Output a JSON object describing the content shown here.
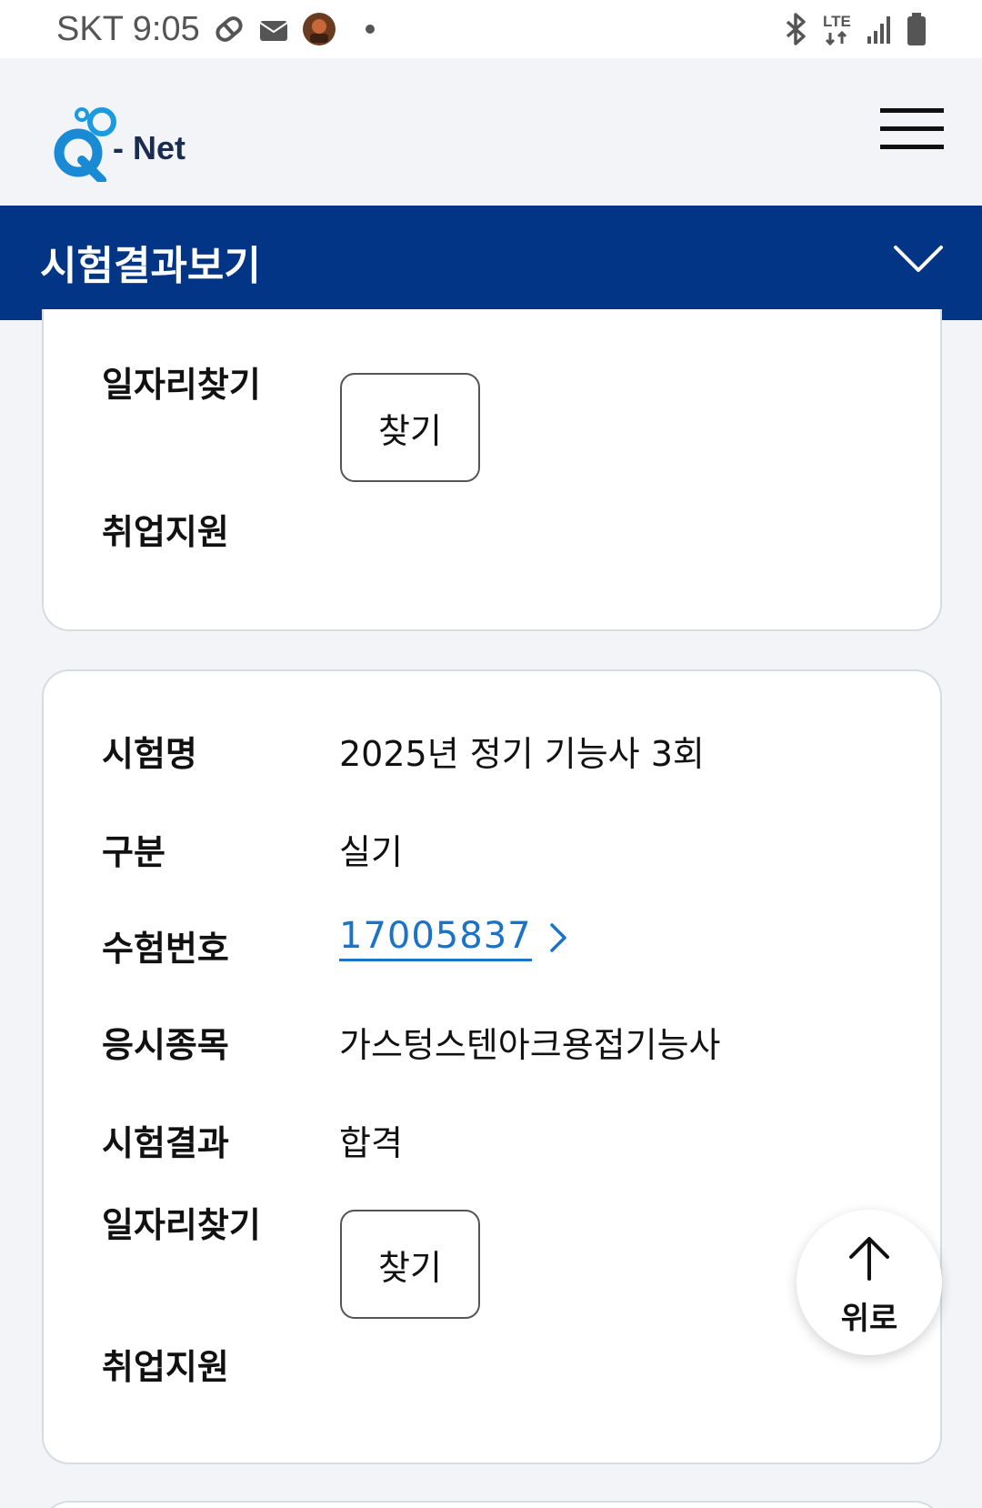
{
  "status_bar": {
    "carrier_time": "SKT 9:05",
    "network": "LTE",
    "icons": [
      "pill-icon",
      "mail-icon",
      "avatar",
      "bluetooth-icon",
      "lte-icon",
      "signal-icon",
      "battery-icon"
    ]
  },
  "header": {
    "logo_text": "- Net",
    "menu_icon": "hamburger-icon"
  },
  "title_bar": {
    "title": "시험결과보기",
    "chevron_icon": "chevron-down-icon",
    "background": "#023586"
  },
  "card1": {
    "job_label": "일자리찾기",
    "find_button": "찾기",
    "employment_label": "취업지원"
  },
  "card2": {
    "exam_name_label": "시험명",
    "exam_name_value": "2025년 정기 기능사 3회",
    "category_label": "구분",
    "category_value": "실기",
    "exam_number_label": "수험번호",
    "exam_number_value": "17005837",
    "subject_label": "응시종목",
    "subject_value": "가스텅스텐아크용접기능사",
    "result_label": "시험결과",
    "result_value": "합격",
    "job_label": "일자리찾기",
    "find_button": "찾기",
    "employment_label": "취업지원"
  },
  "scroll_top": {
    "label": "위로",
    "icon": "arrow-up-icon"
  },
  "colors": {
    "link": "#1a73c7",
    "page_bg": "#f2f4f7"
  }
}
